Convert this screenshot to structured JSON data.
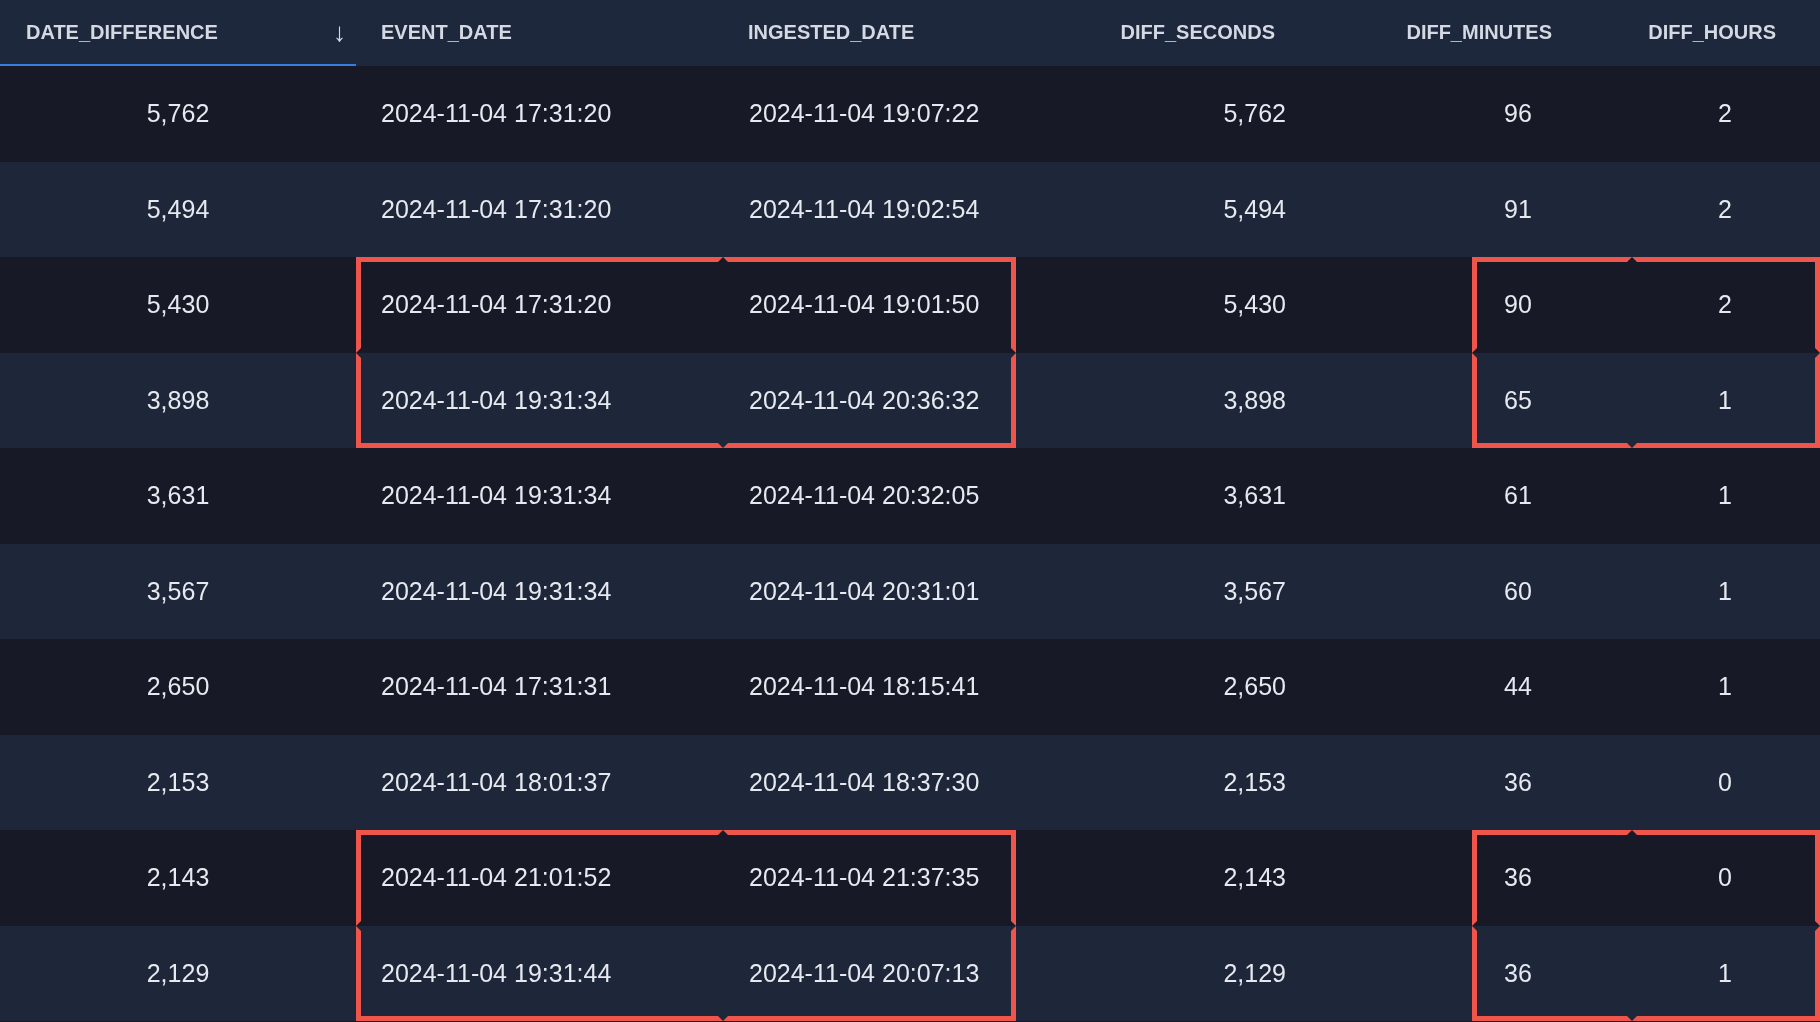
{
  "table": {
    "columns": [
      {
        "label": "DATE_DIFFERENCE",
        "sorted": true,
        "sort_arrow": "↓"
      },
      {
        "label": "EVENT_DATE",
        "sorted": false
      },
      {
        "label": "INGESTED_DATE",
        "sorted": false
      },
      {
        "label": "DIFF_SECONDS",
        "sorted": false
      },
      {
        "label": "DIFF_MINUTES",
        "sorted": false
      },
      {
        "label": "DIFF_HOURS",
        "sorted": false
      }
    ],
    "rows": [
      {
        "cells": [
          {
            "text": "5,762",
            "kind": "plain"
          },
          {
            "text": "2024-11-04 17:31:20",
            "kind": "plain"
          },
          {
            "text": "2024-11-04 19:07:22",
            "kind": "plain"
          },
          {
            "text": "5,762",
            "kind": "plain"
          },
          {
            "text": "96",
            "kind": "plain"
          },
          {
            "text": "2",
            "kind": "plain"
          }
        ]
      },
      {
        "cells": [
          {
            "text": "5,494",
            "kind": "plain"
          },
          {
            "text": "2024-11-04 17:31:20",
            "kind": "plain"
          },
          {
            "text": "2024-11-04 19:02:54",
            "kind": "plain"
          },
          {
            "text": "5,494",
            "kind": "plain"
          },
          {
            "text": "91",
            "kind": "plain"
          },
          {
            "text": "2",
            "kind": "plain"
          }
        ]
      },
      {
        "cells": [
          {
            "text": "5,430",
            "kind": "plain"
          },
          {
            "text": "2024-11-04 17:31:20",
            "kind": "topleft"
          },
          {
            "text": "2024-11-04 19:01:50",
            "kind": "topright"
          },
          {
            "text": "5,430",
            "kind": "plain"
          },
          {
            "text": "90",
            "kind": "topleft"
          },
          {
            "text": "2",
            "kind": "topright"
          }
        ]
      },
      {
        "cells": [
          {
            "text": "3,898",
            "kind": "plain"
          },
          {
            "text": "2024-11-04 19:31:34",
            "kind": "bottomleft"
          },
          {
            "text": "2024-11-04 20:36:32",
            "kind": "bottomright"
          },
          {
            "text": "3,898",
            "kind": "plain"
          },
          {
            "text": "65",
            "kind": "bottomleft"
          },
          {
            "text": "1",
            "kind": "bottomright"
          }
        ]
      },
      {
        "cells": [
          {
            "text": "3,631",
            "kind": "plain"
          },
          {
            "text": "2024-11-04 19:31:34",
            "kind": "plain"
          },
          {
            "text": "2024-11-04 20:32:05",
            "kind": "plain"
          },
          {
            "text": "3,631",
            "kind": "plain"
          },
          {
            "text": "61",
            "kind": "plain"
          },
          {
            "text": "1",
            "kind": "plain"
          }
        ]
      },
      {
        "cells": [
          {
            "text": "3,567",
            "kind": "plain"
          },
          {
            "text": "2024-11-04 19:31:34",
            "kind": "plain"
          },
          {
            "text": "2024-11-04 20:31:01",
            "kind": "plain"
          },
          {
            "text": "3,567",
            "kind": "plain"
          },
          {
            "text": "60",
            "kind": "plain"
          },
          {
            "text": "1",
            "kind": "plain"
          }
        ]
      },
      {
        "cells": [
          {
            "text": "2,650",
            "kind": "plain"
          },
          {
            "text": "2024-11-04 17:31:31",
            "kind": "plain"
          },
          {
            "text": "2024-11-04 18:15:41",
            "kind": "plain"
          },
          {
            "text": "2,650",
            "kind": "plain"
          },
          {
            "text": "44",
            "kind": "plain"
          },
          {
            "text": "1",
            "kind": "plain"
          }
        ]
      },
      {
        "cells": [
          {
            "text": "2,153",
            "kind": "plain"
          },
          {
            "text": "2024-11-04 18:01:37",
            "kind": "plain"
          },
          {
            "text": "2024-11-04 18:37:30",
            "kind": "plain"
          },
          {
            "text": "2,153",
            "kind": "plain"
          },
          {
            "text": "36",
            "kind": "plain"
          },
          {
            "text": "0",
            "kind": "plain"
          }
        ]
      },
      {
        "cells": [
          {
            "text": "2,143",
            "kind": "plain"
          },
          {
            "text": "2024-11-04 21:01:52",
            "kind": "topleft"
          },
          {
            "text": "2024-11-04 21:37:35",
            "kind": "topright"
          },
          {
            "text": "2,143",
            "kind": "plain"
          },
          {
            "text": "36",
            "kind": "topleft"
          },
          {
            "text": "0",
            "kind": "topright"
          }
        ]
      },
      {
        "cells": [
          {
            "text": "2,129",
            "kind": "plain"
          },
          {
            "text": "2024-11-04 19:31:44",
            "kind": "bottomleft"
          },
          {
            "text": "2024-11-04 20:07:13",
            "kind": "bottomright"
          },
          {
            "text": "2,129",
            "kind": "plain"
          },
          {
            "text": "36",
            "kind": "bottomleft"
          },
          {
            "text": "1",
            "kind": "bottomright"
          }
        ]
      }
    ]
  }
}
